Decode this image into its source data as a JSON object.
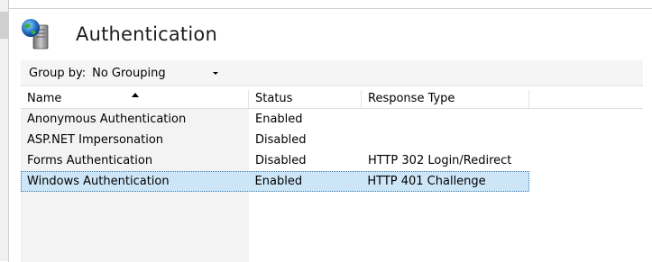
{
  "header": {
    "title": "Authentication",
    "icon": "authentication-icon"
  },
  "groupbar": {
    "label": "Group by:",
    "selected": "No Grouping"
  },
  "table": {
    "columns": [
      "Name",
      "Status",
      "Response Type",
      ""
    ],
    "sorted_column": "Name",
    "sort_direction": "ascending",
    "rows": [
      {
        "name": "Anonymous Authentication",
        "status": "Enabled",
        "response": ""
      },
      {
        "name": "ASP.NET Impersonation",
        "status": "Disabled",
        "response": ""
      },
      {
        "name": "Forms Authentication",
        "status": "Disabled",
        "response": "HTTP 302 Login/Redirect"
      },
      {
        "name": "Windows Authentication",
        "status": "Enabled",
        "response": "HTTP 401 Challenge"
      }
    ],
    "selected_row": 3
  },
  "colors": {
    "selection_fill": "#cde6f7",
    "selection_border": "#3c7fb1",
    "groupbar_bg": "#f5f5f5"
  }
}
